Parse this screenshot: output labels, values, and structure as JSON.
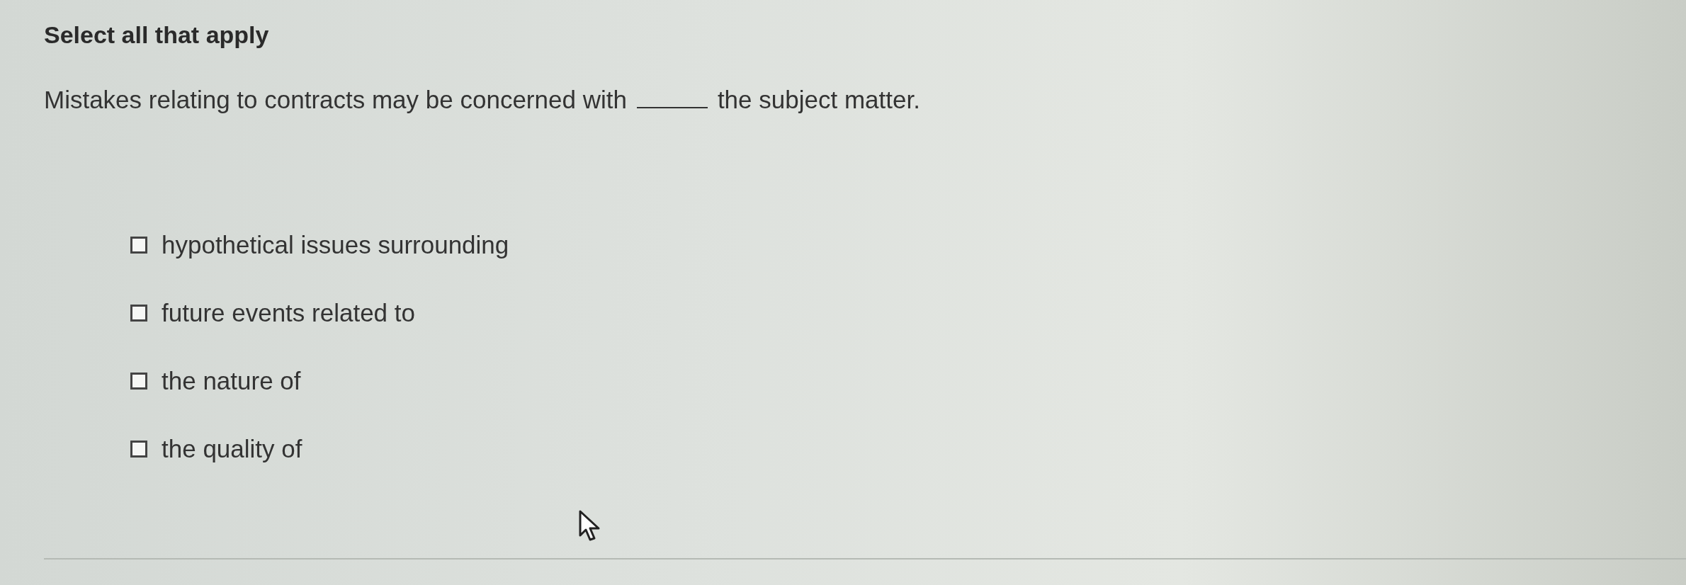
{
  "heading": "Select all that apply",
  "question": {
    "before": "Mistakes relating to contracts may be concerned with",
    "after": "the subject matter."
  },
  "options": [
    {
      "label": "hypothetical issues surrounding",
      "checked": false
    },
    {
      "label": "future events related to",
      "checked": false
    },
    {
      "label": "the nature of",
      "checked": false
    },
    {
      "label": "the quality of",
      "checked": false
    }
  ]
}
